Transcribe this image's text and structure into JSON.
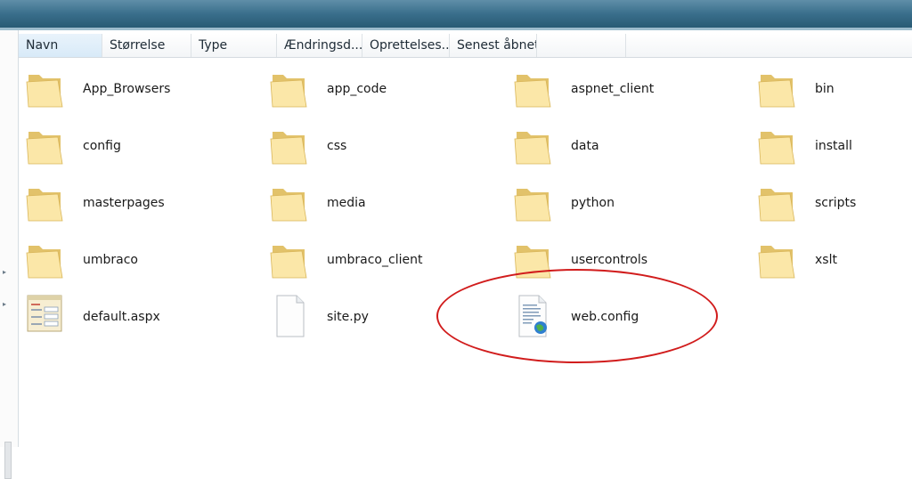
{
  "columns": {
    "name": "Navn",
    "size": "Størrelse",
    "type": "Type",
    "modified": "Ændringsd...",
    "created": "Oprettelses...",
    "accessed": "Senest åbnet"
  },
  "folders": [
    {
      "label": "App_Browsers"
    },
    {
      "label": "app_code"
    },
    {
      "label": "aspnet_client"
    },
    {
      "label": "bin"
    },
    {
      "label": "config"
    },
    {
      "label": "css"
    },
    {
      "label": "data"
    },
    {
      "label": "install"
    },
    {
      "label": "masterpages"
    },
    {
      "label": "media"
    },
    {
      "label": "python"
    },
    {
      "label": "scripts"
    },
    {
      "label": "umbraco"
    },
    {
      "label": "umbraco_client"
    },
    {
      "label": "usercontrols"
    },
    {
      "label": "xslt"
    }
  ],
  "files": [
    {
      "label": "default.aspx",
      "icon": "aspx-file-icon"
    },
    {
      "label": "site.py",
      "icon": "blank-file-icon"
    },
    {
      "label": "web.config",
      "icon": "config-file-icon"
    }
  ],
  "highlight": {
    "target": "web.config",
    "color": "#d11c1c"
  }
}
